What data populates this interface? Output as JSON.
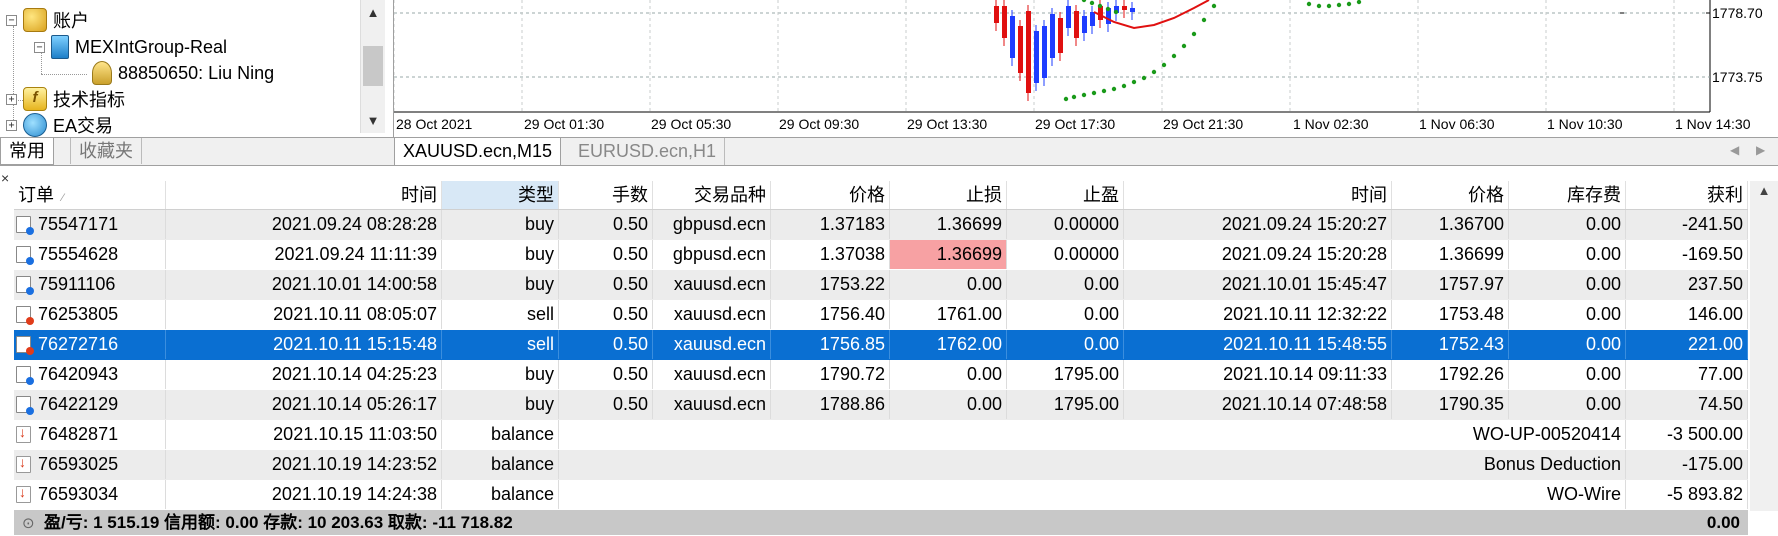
{
  "navigator": {
    "items": [
      {
        "label": "账户",
        "icon": "accounts-icon",
        "expander": "−"
      },
      {
        "label": "MEXIntGroup-Real",
        "icon": "server-icon",
        "expander": "−"
      },
      {
        "label": "88850650: Liu Ning",
        "icon": "user-icon",
        "expander": ""
      },
      {
        "label": "技术指标",
        "icon": "indicators-icon",
        "expander": "+"
      },
      {
        "label": "EA交易",
        "icon": "expert-advisor-icon",
        "expander": "+"
      }
    ],
    "tabs": [
      "常用",
      "收藏夹"
    ]
  },
  "chart": {
    "price_labels": [
      "1778.70",
      "1773.75"
    ],
    "time_labels": [
      "28 Oct 2021",
      "29 Oct 01:30",
      "29 Oct 05:30",
      "29 Oct 09:30",
      "29 Oct 13:30",
      "29 Oct 17:30",
      "29 Oct 21:30",
      "1 Nov 02:30",
      "1 Nov 06:30",
      "1 Nov 10:30",
      "1 Nov 14:30"
    ],
    "tabs": [
      "XAUUSD.ecn,M15",
      "EURUSD.ecn,H1"
    ],
    "colors": {
      "bull": "#1e3cff",
      "bear": "#e01010",
      "ma": "#e01010",
      "sar": "#1a9a1a"
    }
  },
  "history": {
    "headers": [
      "订单",
      "时间",
      "类型",
      "手数",
      "交易品种",
      "价格",
      "止损",
      "止盈",
      "时间",
      "价格",
      "库存费",
      "获利"
    ],
    "sort_mark": "⁄",
    "rows": [
      {
        "icon": "buy",
        "cells": [
          "75547171",
          "2021.09.24 08:28:28",
          "buy",
          "0.50",
          "gbpusd.ecn",
          "1.37183",
          "1.36699",
          "0.00000",
          "2021.09.24 15:20:27",
          "1.36700",
          "0.00",
          "-241.50"
        ]
      },
      {
        "icon": "buy",
        "cells": [
          "75554628",
          "2021.09.24 11:11:39",
          "buy",
          "0.50",
          "gbpusd.ecn",
          "1.37038",
          "1.36699",
          "0.00000",
          "2021.09.24 15:20:28",
          "1.36699",
          "0.00",
          "-169.50"
        ],
        "hl": 6
      },
      {
        "icon": "buy",
        "cells": [
          "75911106",
          "2021.10.01 14:00:58",
          "buy",
          "0.50",
          "xauusd.ecn",
          "1753.22",
          "0.00",
          "0.00",
          "2021.10.01 15:45:47",
          "1757.97",
          "0.00",
          "237.50"
        ]
      },
      {
        "icon": "sell",
        "cells": [
          "76253805",
          "2021.10.11 08:05:07",
          "sell",
          "0.50",
          "xauusd.ecn",
          "1756.40",
          "1761.00",
          "0.00",
          "2021.10.11 12:32:22",
          "1753.48",
          "0.00",
          "146.00"
        ]
      },
      {
        "icon": "sell",
        "cells": [
          "76272716",
          "2021.10.11 15:15:48",
          "sell",
          "0.50",
          "xauusd.ecn",
          "1756.85",
          "1762.00",
          "0.00",
          "2021.10.11 15:48:55",
          "1752.43",
          "0.00",
          "221.00"
        ],
        "selected": true
      },
      {
        "icon": "buy",
        "cells": [
          "76420943",
          "2021.10.14 04:25:23",
          "buy",
          "0.50",
          "xauusd.ecn",
          "1790.72",
          "0.00",
          "1795.00",
          "2021.10.14 09:11:33",
          "1792.26",
          "0.00",
          "77.00"
        ]
      },
      {
        "icon": "buy",
        "cells": [
          "76422129",
          "2021.10.14 05:26:17",
          "buy",
          "0.50",
          "xauusd.ecn",
          "1788.86",
          "0.00",
          "1795.00",
          "2021.10.14 07:48:58",
          "1790.35",
          "0.00",
          "74.50"
        ]
      },
      {
        "icon": "balance",
        "balance": true,
        "cells": [
          "76482871",
          "2021.10.15 11:03:50",
          "balance",
          "WO-UP-00520414",
          "-3 500.00"
        ]
      },
      {
        "icon": "balance",
        "balance": true,
        "cells": [
          "76593025",
          "2021.10.19 14:23:52",
          "balance",
          "Bonus Deduction",
          "-175.00"
        ]
      },
      {
        "icon": "balance",
        "balance": true,
        "cells": [
          "76593034",
          "2021.10.19 14:24:38",
          "balance",
          "WO-Wire",
          "-5 893.82"
        ]
      }
    ],
    "summary": {
      "text": "盈/亏: 1 515.19  信用额: 0.00  存款: 10 203.63  取款: -11 718.82",
      "total": "0.00"
    }
  }
}
